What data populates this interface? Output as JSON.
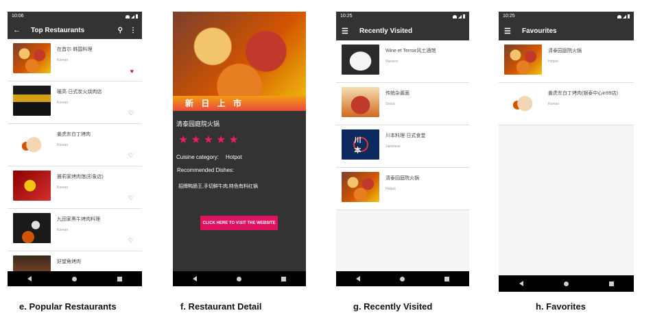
{
  "screen_e": {
    "status_time": "10:06",
    "title": "Top Restaurants",
    "items": [
      {
        "name": "在首尔·韩国料理",
        "category": "Korean"
      },
      {
        "name": "暖高·日式炭火烧肉店",
        "category": "Korean"
      },
      {
        "name": "姜虎东白丁烤肉",
        "category": "Korean"
      },
      {
        "name": "雅莉家烤肉馆(形象店)",
        "category": "Korean"
      },
      {
        "name": "九田家黑牛烤肉料理",
        "category": "Korean"
      },
      {
        "name": "好望角烤肉",
        "category": ""
      }
    ],
    "caption": "e. Popular Restaurants"
  },
  "screen_f": {
    "hero_band_text": "新 日 上 市",
    "restaurant_name": "清泰园庭院火锅",
    "rating": 5,
    "cuisine_label": "Cuisine category:",
    "cuisine_value": "Hotpot",
    "recommended_label": "Recommended Dishes:",
    "recommended_value": "招牌鸭肠王,手切鲜牛肉,特色有料红锅",
    "button_label": "CLICK HERE TO VISIT THE WEBSITE",
    "caption": "f. Restaurant Detail"
  },
  "screen_g": {
    "status_time": "10:25",
    "title": "Recently Visited",
    "items": [
      {
        "name": "Wine et Terroir风土酒馆",
        "category": "Western"
      },
      {
        "name": "传统杂酱面",
        "category": "Snack"
      },
      {
        "name": "川本料理·日式食堂",
        "category": "Japanese"
      },
      {
        "name": "清泰园庭院火锅",
        "category": "Hotpot"
      }
    ],
    "logo_text": "川本",
    "caption": "g. Recently Visited"
  },
  "screen_h": {
    "status_time": "10:25",
    "title": "Favourites",
    "items": [
      {
        "name": "清泰园庭院火锅",
        "category": "Hotpot"
      },
      {
        "name": "姜虎东白丁烤肉(银泰中心in99店)",
        "category": "Korean"
      }
    ],
    "caption": "h. Favorites"
  },
  "icons": {
    "back": "arrow-left-icon",
    "search": "search-icon",
    "overflow": "more-vert-icon",
    "menu": "menu-icon",
    "heart": "heart-icon",
    "star": "star-icon"
  },
  "colors": {
    "appbar": "#333333",
    "accent": "#e0115f",
    "heart": "#c2185b"
  }
}
